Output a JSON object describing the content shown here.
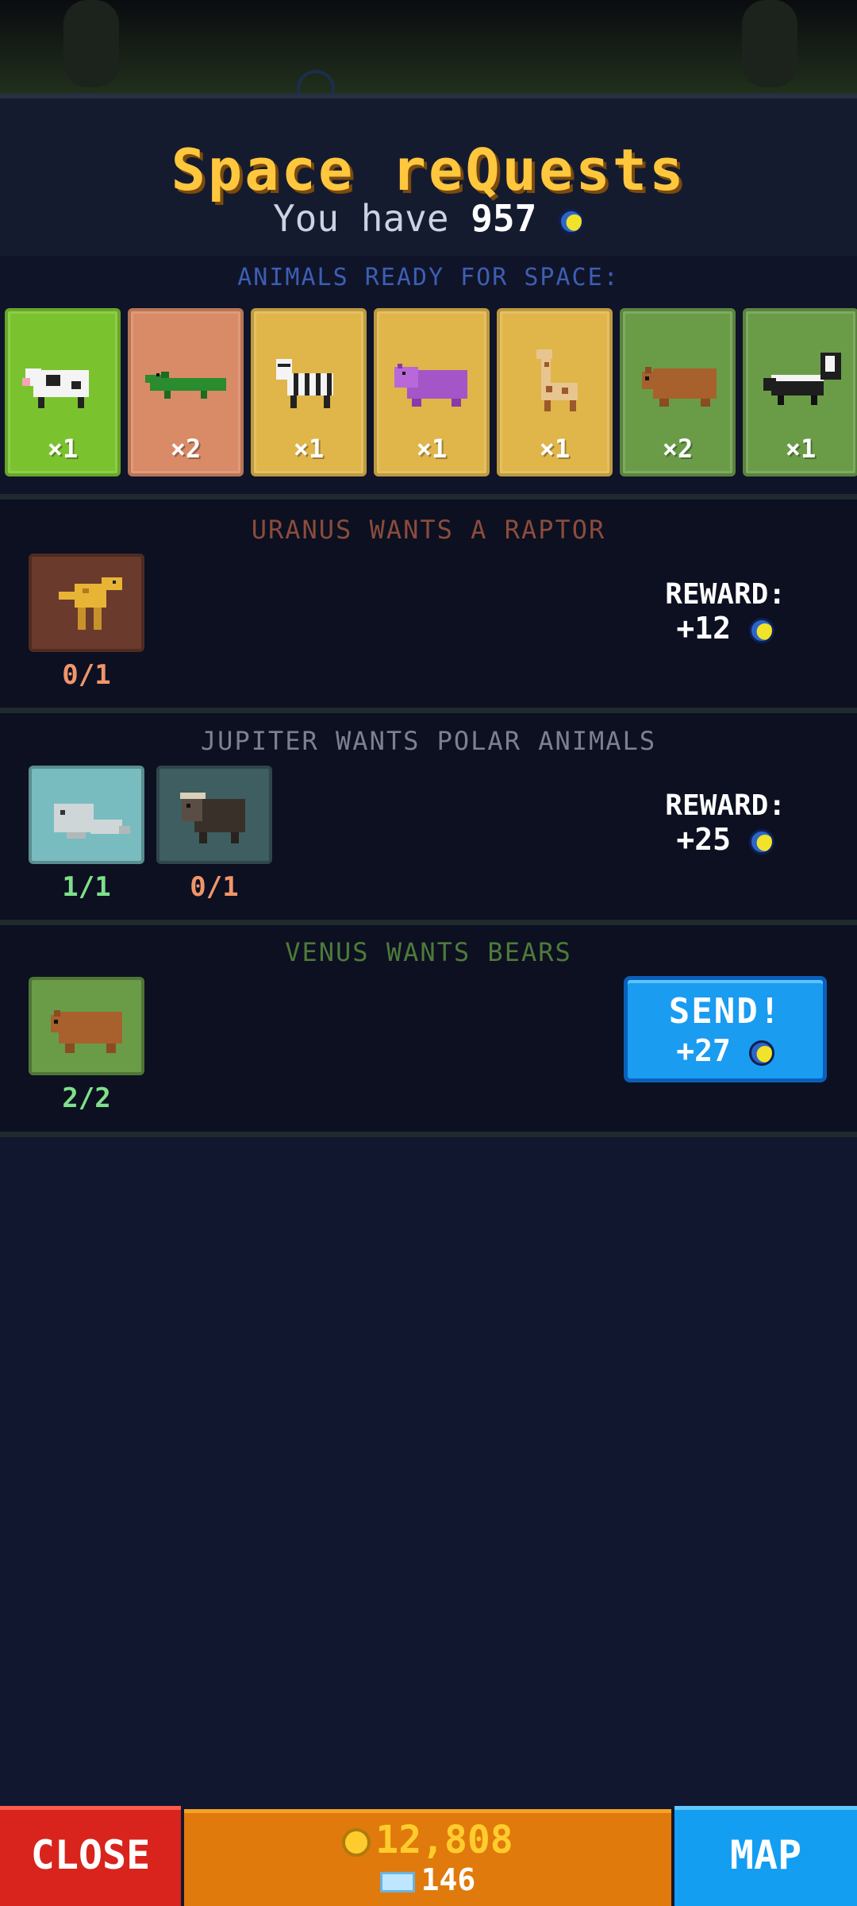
{
  "header": {
    "title": "Space reQuests",
    "you_have_label": "You have",
    "currency_amount": "957",
    "currency_icon": "moon-coin-icon"
  },
  "ready": {
    "title": "ANIMALS READY FOR SPACE:",
    "cards": [
      {
        "animal": "cow",
        "count": "×1",
        "color": "#7bc32e"
      },
      {
        "animal": "crocodile",
        "count": "×2",
        "color": "#d98a66"
      },
      {
        "animal": "zebra",
        "count": "×1",
        "color": "#e0b54a"
      },
      {
        "animal": "hippo",
        "count": "×1",
        "color": "#e0b54a"
      },
      {
        "animal": "giraffe",
        "count": "×1",
        "color": "#e0b54a"
      },
      {
        "animal": "bear",
        "count": "×2",
        "color": "#6a9c48"
      },
      {
        "animal": "skunk",
        "count": "×1",
        "color": "#6a9c48"
      }
    ]
  },
  "requests": [
    {
      "title": "URANUS WANTS A RAPTOR",
      "title_color": "#8a4c3c",
      "slots": [
        {
          "animal": "raptor",
          "progress": "0/1",
          "progress_color": "#f0956a"
        }
      ],
      "reward_label": "REWARD:",
      "reward_value": "+12"
    },
    {
      "title": "JUPITER WANTS POLAR ANIMALS",
      "title_color": "#7c8190",
      "slots": [
        {
          "animal": "seal",
          "progress": "1/1",
          "progress_color": "#7ee08a"
        },
        {
          "animal": "muskox",
          "progress": "0/1",
          "progress_color": "#f0956a"
        }
      ],
      "reward_label": "REWARD:",
      "reward_value": "+25"
    },
    {
      "title": "VENUS WANTS BEARS",
      "title_color": "#4e7a3a",
      "slots": [
        {
          "animal": "bear",
          "progress": "2/2",
          "progress_color": "#7ee08a"
        }
      ],
      "send_label": "SEND!",
      "reward_value": "+27"
    }
  ],
  "bottom": {
    "close_label": "CLOSE",
    "gold_amount": "12,808",
    "gem_amount": "146",
    "map_label": "MAP"
  },
  "colors": {
    "accent_title": "#ffc73d",
    "send_button": "#1a9cf0",
    "close_button": "#d8241c",
    "map_button": "#139ef2",
    "money_bar": "#e07a0c"
  }
}
